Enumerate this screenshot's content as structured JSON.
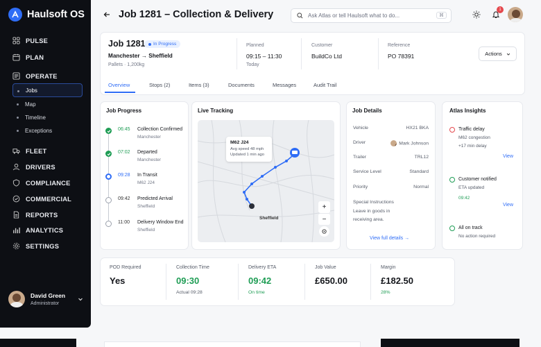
{
  "app": {
    "name": "Haulsoft OS"
  },
  "sidebar": {
    "items": [
      {
        "label": "PULSE"
      },
      {
        "label": "PLAN"
      },
      {
        "label": "OPERATE"
      },
      {
        "label": "FLEET"
      },
      {
        "label": "DRIVERS"
      },
      {
        "label": "COMPLIANCE"
      },
      {
        "label": "COMMERCIAL"
      },
      {
        "label": "REPORTS"
      },
      {
        "label": "ANALYTICS"
      },
      {
        "label": "SETTINGS"
      }
    ],
    "subitems": [
      {
        "label": "Jobs"
      },
      {
        "label": "Map"
      },
      {
        "label": "Timeline"
      },
      {
        "label": "Exceptions"
      }
    ],
    "user": {
      "name": "David Green",
      "role": "Administrator"
    }
  },
  "header": {
    "title": "Job 1281 – Collection & Delivery",
    "search_placeholder": "Ask Atlas or tell Haulsoft what to do...",
    "search_shortcut": "⌘",
    "notification_count": "1"
  },
  "job": {
    "title": "Job 1281",
    "status": "In Progress",
    "route": "Manchester → Sheffield",
    "meta": "Pallets  ·  1,200kg",
    "planned_label": "Planned",
    "planned_value": "09:15 – 11:30",
    "planned_sub": "Today",
    "customer_label": "Customer",
    "customer_value": "BuildCo Ltd",
    "reference_label": "Reference",
    "reference_value": "PO 78391",
    "actions_label": "Actions"
  },
  "tabs": [
    {
      "label": "Overview"
    },
    {
      "label": "Stops (2)"
    },
    {
      "label": "Items (3)"
    },
    {
      "label": "Documents"
    },
    {
      "label": "Messages"
    },
    {
      "label": "Audit Trail"
    }
  ],
  "progress": {
    "title": "Job Progress",
    "steps": [
      {
        "time": "06:45",
        "name": "Collection Confirmed",
        "place": "Manchester",
        "state": "done"
      },
      {
        "time": "07:02",
        "name": "Departed",
        "place": "Manchester",
        "state": "done"
      },
      {
        "time": "09:28",
        "name": "In Transit",
        "place": "M62 J24",
        "state": "current"
      },
      {
        "time": "09:42",
        "name": "Predicted Arrival",
        "place": "Sheffield",
        "state": "pending"
      },
      {
        "time": "11:00",
        "name": "Delivery Window End",
        "place": "Sheffield",
        "state": "pending"
      }
    ]
  },
  "tracking": {
    "title": "Live Tracking",
    "popup_title": "M62 J24",
    "popup_speed": "Avg speed 48 mph",
    "popup_updated": "Updated 1 min ago",
    "destination": "Sheffield",
    "zoom_in": "+",
    "zoom_out": "−"
  },
  "details": {
    "title": "Job Details",
    "rows": [
      {
        "key": "Vehicle",
        "value": "HX21 BKA"
      },
      {
        "key": "Driver",
        "value": "Mark Johnson"
      },
      {
        "key": "Trailer",
        "value": "TRL12"
      },
      {
        "key": "Service Level",
        "value": "Standard"
      },
      {
        "key": "Priority",
        "value": "Normal"
      }
    ],
    "instructions_label": "Special Instructions",
    "instructions_value": "Leave in goods in receiving area.",
    "view_full": "View full details →"
  },
  "insights": {
    "title": "Atlas Insights",
    "items": [
      {
        "title": "Traffic delay",
        "line1": "M62 congestion",
        "line2": "+17 min delay",
        "link": "View",
        "color": "#e5484d"
      },
      {
        "title": "Customer notified",
        "line1": "ETA updated",
        "line2": "09:42",
        "link": "View",
        "color": "#1f9d55"
      },
      {
        "title": "All on track",
        "line1": "No action required",
        "line2": "",
        "link": "",
        "color": "#1f9d55"
      }
    ]
  },
  "kpis": [
    {
      "label": "POD Required",
      "value": "Yes",
      "sub": "",
      "color": "#15171c"
    },
    {
      "label": "Collection Time",
      "value": "09:30",
      "sub": "Actual 09:28",
      "color": "#1f9d55"
    },
    {
      "label": "Delivery ETA",
      "value": "09:42",
      "sub": "On time",
      "color": "#1f9d55"
    },
    {
      "label": "Job Value",
      "value": "£650.00",
      "sub": "",
      "color": "#15171c"
    },
    {
      "label": "Margin",
      "value": "£182.50",
      "sub": "28%",
      "color": "#15171c"
    }
  ],
  "colors": {
    "accent": "#2f6df6",
    "success": "#1f9d55",
    "danger": "#e5484d",
    "sidebar": "#0d0f14"
  }
}
